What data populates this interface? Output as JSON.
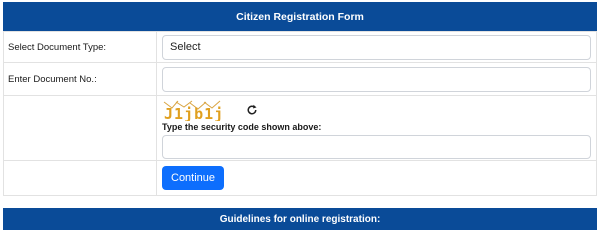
{
  "header": {
    "title": "Citizen Registration Form"
  },
  "form": {
    "document_type": {
      "label": "Select Document Type:",
      "value": "Select"
    },
    "document_no": {
      "label": "Enter Document No.:",
      "value": ""
    },
    "captcha": {
      "code": "J1jb1j",
      "instruction": "Type the security code shown above:",
      "value": "",
      "refresh_icon": "refresh-icon"
    },
    "continue_label": "Continue"
  },
  "footer": {
    "title": "Guidelines for online registration:"
  },
  "colors": {
    "header_bg": "#0a4b98",
    "button_bg": "#0d6efd"
  }
}
